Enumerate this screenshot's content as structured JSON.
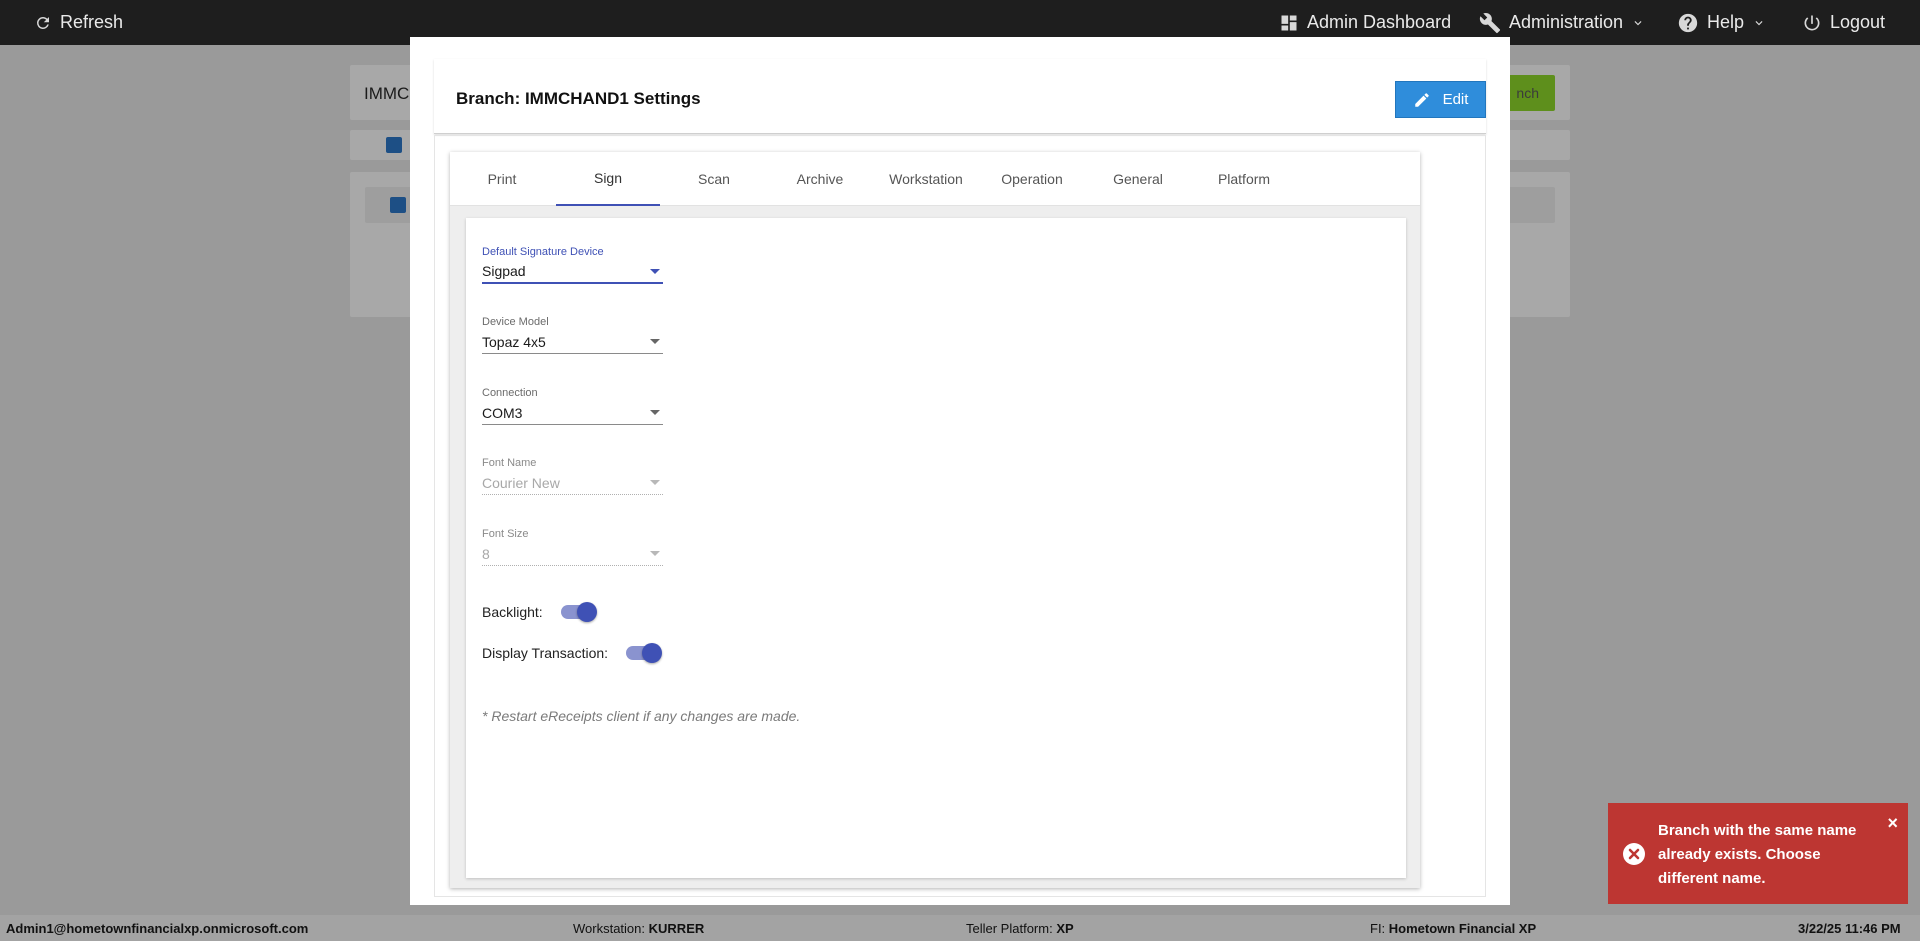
{
  "topbar": {
    "refresh": "Refresh",
    "admin_dashboard": "Admin Dashboard",
    "administration": "Administration",
    "help": "Help",
    "logout": "Logout"
  },
  "background": {
    "branch_input_value": "IMMCH",
    "add_branch_label": "nch"
  },
  "modal": {
    "title": "Branch: IMMCHAND1 Settings",
    "edit_label": "Edit",
    "tabs": [
      "Print",
      "Sign",
      "Scan",
      "Archive",
      "Workstation",
      "Operation",
      "General",
      "Platform"
    ],
    "active_tab": "Sign",
    "fields": {
      "signature_device": {
        "label": "Default Signature Device",
        "value": "Sigpad"
      },
      "device_model": {
        "label": "Device Model",
        "value": "Topaz 4x5"
      },
      "connection": {
        "label": "Connection",
        "value": "COM3"
      },
      "font_name": {
        "label": "Font Name",
        "value": "Courier New"
      },
      "font_size": {
        "label": "Font Size",
        "value": "8"
      }
    },
    "toggles": {
      "backlight": {
        "label": "Backlight:",
        "on": true
      },
      "display_transaction": {
        "label": "Display Transaction:",
        "on": true
      }
    },
    "note": "* Restart eReceipts client if any changes are made."
  },
  "toast": {
    "message": "Branch with the same name already exists. Choose different name.",
    "close": "×",
    "color": "#bd3632"
  },
  "statusbar": {
    "user": "Admin1@hometownfinancialxp.onmicrosoft.com",
    "workstation_label": "Workstation:",
    "workstation_value": "KURRER",
    "platform_label": "Teller Platform:",
    "platform_value": "XP",
    "fi_label": "FI:",
    "fi_value": "Hometown Financial XP",
    "datetime": "3/22/25 11:46 PM"
  },
  "colors": {
    "accent": "#3f51b5",
    "edit_button": "#2f8ddb",
    "topbar": "#1e1e1e"
  }
}
